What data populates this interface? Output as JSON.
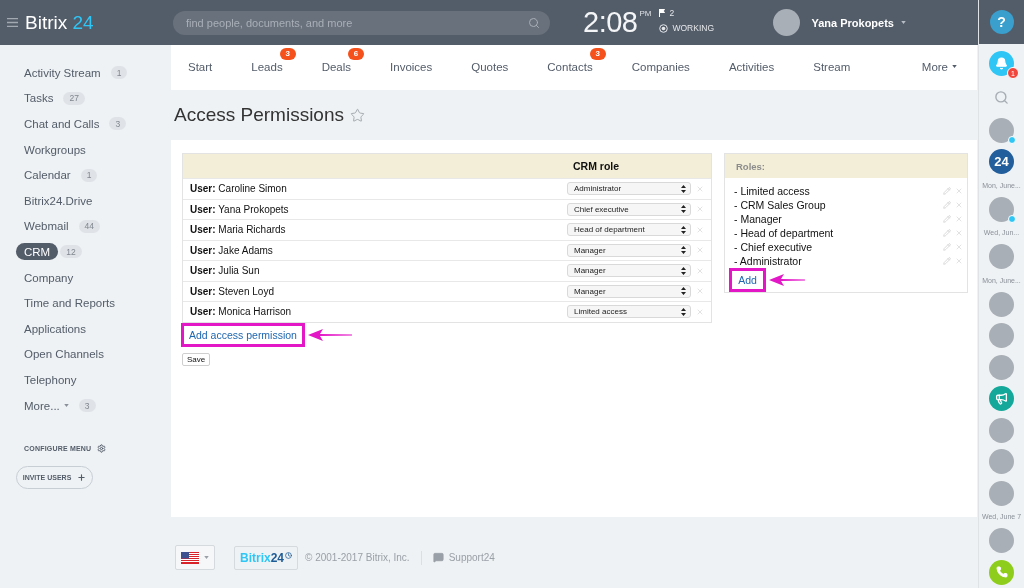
{
  "top_bar": {
    "logo": {
      "name": "Bitrix",
      "number": "24"
    },
    "search": {
      "placeholder": "find people, documents, and more"
    },
    "clock": {
      "time": "2:08",
      "period": "PM"
    },
    "flags": "2",
    "status": "WORKING",
    "user": {
      "name": "Yana Prokopets"
    }
  },
  "sidebar": {
    "items": [
      {
        "label": "Activity Stream",
        "count": "1",
        "selected": false,
        "kind": "link"
      },
      {
        "label": "Tasks",
        "count": "27",
        "selected": false,
        "kind": "link"
      },
      {
        "label": "Chat and Calls",
        "count": "3",
        "selected": false,
        "kind": "link"
      },
      {
        "label": "Workgroups",
        "selected": false,
        "kind": "link"
      },
      {
        "label": "Calendar",
        "count": "1",
        "selected": false,
        "kind": "link"
      },
      {
        "label": "Bitrix24.Drive",
        "selected": false,
        "kind": "link"
      },
      {
        "label": "Webmail",
        "count": "44",
        "selected": false,
        "kind": "link"
      },
      {
        "label": "CRM",
        "count": "12",
        "selected": true,
        "kind": "link"
      },
      {
        "label": "Company",
        "selected": false,
        "kind": "link"
      },
      {
        "label": "Time and Reports",
        "selected": false,
        "kind": "link"
      },
      {
        "label": "Applications",
        "selected": false,
        "kind": "link"
      },
      {
        "label": "Open Channels",
        "selected": false,
        "kind": "link"
      },
      {
        "label": "Telephony",
        "selected": false,
        "kind": "link"
      },
      {
        "label": "More...",
        "count": "3",
        "selected": false,
        "kind": "menu"
      }
    ],
    "configure": "CONFIGURE MENU",
    "invite": "INVITE USERS"
  },
  "nav": {
    "tabs": [
      {
        "label": "Start",
        "selected": false,
        "kind": "link"
      },
      {
        "label": "Leads",
        "badge": "3",
        "selected": false,
        "kind": "link"
      },
      {
        "label": "Deals",
        "badge": "6",
        "selected": false,
        "kind": "link"
      },
      {
        "label": "Invoices",
        "selected": false,
        "kind": "link"
      },
      {
        "label": "Quotes",
        "selected": false,
        "kind": "link"
      },
      {
        "label": "Contacts",
        "badge": "3",
        "selected": false,
        "kind": "link"
      },
      {
        "label": "Companies",
        "selected": false,
        "kind": "link"
      },
      {
        "label": "Activities",
        "selected": false,
        "kind": "link"
      },
      {
        "label": "Stream",
        "selected": false,
        "kind": "link"
      },
      {
        "label": "More",
        "selected": false,
        "kind": "menu"
      }
    ]
  },
  "page": {
    "title": "Access Permissions"
  },
  "permissions": {
    "role_column": "CRM role",
    "rows": [
      {
        "user": "**User:** Caroline Simon",
        "role": "Administrator"
      },
      {
        "user": "**User:** Yana Prokopets",
        "role": "Chief executive"
      },
      {
        "user": "**User:** Maria Richards",
        "role": "Head of department"
      },
      {
        "user": "**User:** Jake Adams",
        "role": "Manager"
      },
      {
        "user": "**User:** Julia Sun",
        "role": "Manager"
      },
      {
        "user": "**User:** Steven Loyd",
        "role": "Manager"
      },
      {
        "user": "**User:** Monica Harrison",
        "role": "Limited access"
      }
    ],
    "add_link": {
      "label": "Add access permission",
      "highlighted": true
    },
    "save": "Save"
  },
  "roles": {
    "title": "Roles:",
    "items": [
      "- Limited access",
      "- CRM Sales Group",
      "- Manager",
      "- Head of department",
      "- Chief executive",
      "- Administrator"
    ],
    "add_link": {
      "label": "Add",
      "highlighted": true
    }
  },
  "rail": {
    "help": "?",
    "items": [
      {
        "kind": "notifications",
        "badge": "1"
      },
      {
        "kind": "search"
      },
      {
        "kind": "avatar",
        "status": true
      },
      {
        "kind": "logo",
        "label": "24",
        "caption": "Mon, June..."
      },
      {
        "kind": "avatar",
        "status": true,
        "caption": "Wed, Jun..."
      },
      {
        "kind": "avatar",
        "status": false,
        "caption": "Mon, June..."
      },
      {
        "kind": "avatar",
        "status": false
      },
      {
        "kind": "avatar",
        "status": false
      },
      {
        "kind": "avatar",
        "status": false
      },
      {
        "kind": "megaphone"
      },
      {
        "kind": "avatar",
        "status": false
      },
      {
        "kind": "avatar",
        "status": false
      },
      {
        "kind": "avatar",
        "status": false,
        "caption": "Wed, June 7"
      },
      {
        "kind": "avatar",
        "status": false
      },
      {
        "kind": "phone"
      }
    ]
  },
  "footer": {
    "logo": {
      "name": "Bitrix",
      "number": "24"
    },
    "copyright": "© 2001-2017 Bitrix, Inc.",
    "support": "Support24"
  }
}
